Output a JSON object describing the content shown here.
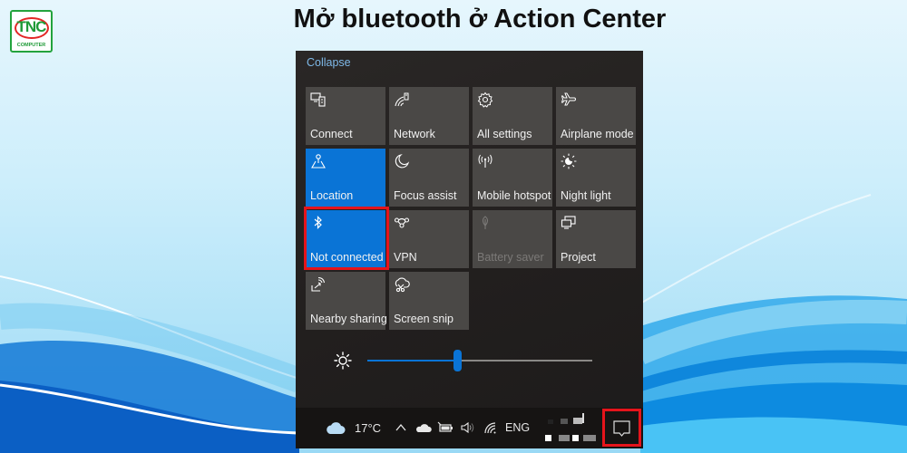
{
  "page": {
    "title": "Mở bluetooth ở Action Center",
    "logo": {
      "brand": "TNC",
      "subtitle": "COMPUTER",
      "colors": {
        "green": "#1f9a37",
        "red": "#e32626"
      }
    }
  },
  "action_center": {
    "collapse_label": "Collapse",
    "accent_color": "#0a74d6",
    "highlight_color": "#e5141b",
    "tiles": [
      {
        "label": "Connect",
        "icon": "connect-icon",
        "state": "off"
      },
      {
        "label": "Network",
        "icon": "network-icon",
        "state": "off"
      },
      {
        "label": "All settings",
        "icon": "gear-icon",
        "state": "off"
      },
      {
        "label": "Airplane mode",
        "icon": "airplane-icon",
        "state": "off"
      },
      {
        "label": "Location",
        "icon": "location-icon",
        "state": "on"
      },
      {
        "label": "Focus assist",
        "icon": "moon-icon",
        "state": "off"
      },
      {
        "label": "Mobile hotspot",
        "icon": "hotspot-icon",
        "state": "off"
      },
      {
        "label": "Night light",
        "icon": "night-light-icon",
        "state": "off"
      },
      {
        "label": "Not connected",
        "icon": "bluetooth-icon",
        "state": "on",
        "highlighted": true
      },
      {
        "label": "VPN",
        "icon": "vpn-icon",
        "state": "off"
      },
      {
        "label": "Battery saver",
        "icon": "leaf-icon",
        "state": "disabled"
      },
      {
        "label": "Project",
        "icon": "project-icon",
        "state": "off"
      },
      {
        "label": "Nearby sharing",
        "icon": "nearby-sharing-icon",
        "state": "off"
      },
      {
        "label": "Screen snip",
        "icon": "scissors-icon",
        "state": "off"
      }
    ],
    "brightness": {
      "icon": "brightness-icon",
      "value_percent": 40
    }
  },
  "taskbar": {
    "weather": {
      "icon": "cloud-icon",
      "temperature": "17°C"
    },
    "tray_icons": [
      "chevron-up-icon",
      "onedrive-icon",
      "battery-icon",
      "volume-icon",
      "wifi-icon"
    ],
    "language": "ENG",
    "notification_icon": "notification-icon",
    "notification_highlighted": true
  }
}
